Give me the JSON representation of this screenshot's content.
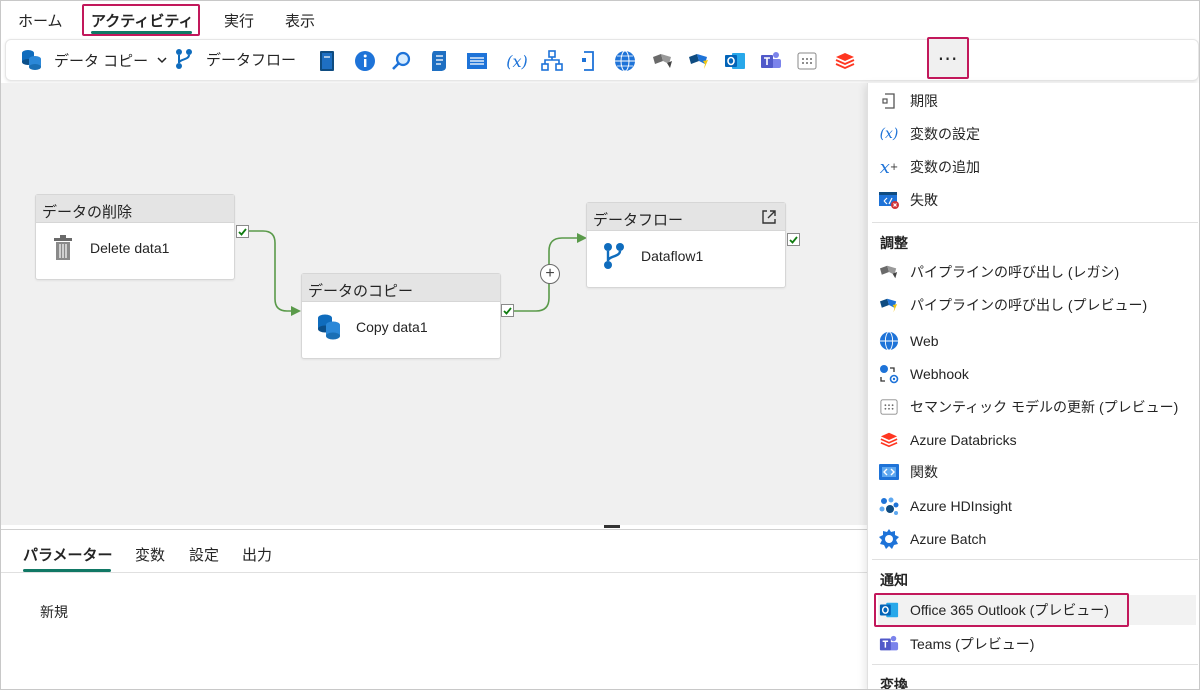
{
  "tabs": {
    "home": "ホーム",
    "activity": "アクティビティ",
    "run": "実行",
    "view": "表示"
  },
  "toolbar": {
    "copy_data": "データ コピー",
    "dataflow": "データフロー",
    "more": "⋯",
    "icons": [
      "notebook-icon",
      "info-icon",
      "lookup-icon",
      "script-icon",
      "list-icon",
      "variable-icon",
      "switch-icon",
      "until-icon",
      "web-icon",
      "invoke-pipeline-legacy-icon",
      "invoke-pipeline-icon",
      "outlook-icon",
      "teams-icon",
      "semantic-model-icon",
      "databricks-icon"
    ]
  },
  "canvas": {
    "nodes": [
      {
        "header": "データの削除",
        "label": "Delete data1"
      },
      {
        "header": "データのコピー",
        "label": "Copy data1"
      },
      {
        "header": "データフロー",
        "label": "Dataflow1"
      }
    ]
  },
  "bottom": {
    "tabs": [
      "パラメーター",
      "変数",
      "設定",
      "出力"
    ],
    "new_label": "新規"
  },
  "menu": {
    "items_top": [
      {
        "label": "期限",
        "icon": "timeout-icon"
      },
      {
        "label": "変数の設定",
        "icon": "set-variable-icon"
      },
      {
        "label": "変数の追加",
        "icon": "append-variable-icon"
      },
      {
        "label": "失敗",
        "icon": "fail-icon"
      }
    ],
    "section_orchestrate": "調整",
    "items_orchestrate": [
      {
        "label": "パイプラインの呼び出し (レガシ)",
        "icon": "invoke-pipeline-legacy-icon"
      },
      {
        "label": "パイプラインの呼び出し (プレビュー)",
        "icon": "invoke-pipeline-icon"
      },
      {
        "label": "Web",
        "icon": "web-icon"
      },
      {
        "label": "Webhook",
        "icon": "webhook-icon"
      },
      {
        "label": "セマンティック モデルの更新 (プレビュー)",
        "icon": "semantic-model-icon"
      },
      {
        "label": "Azure Databricks",
        "icon": "databricks-icon"
      },
      {
        "label": "関数",
        "icon": "function-icon"
      },
      {
        "label": "Azure HDInsight",
        "icon": "hdinsight-icon"
      },
      {
        "label": "Azure Batch",
        "icon": "batch-icon"
      }
    ],
    "section_notify": "通知",
    "items_notify": [
      {
        "label": "Office 365 Outlook (プレビュー)",
        "icon": "outlook-icon"
      },
      {
        "label": "Teams (プレビュー)",
        "icon": "teams-icon"
      }
    ],
    "section_transform": "変換"
  },
  "colors": {
    "accent": "#117865",
    "highlight": "#c2185b",
    "success": "#107c10",
    "link": "#0f6cbd"
  }
}
